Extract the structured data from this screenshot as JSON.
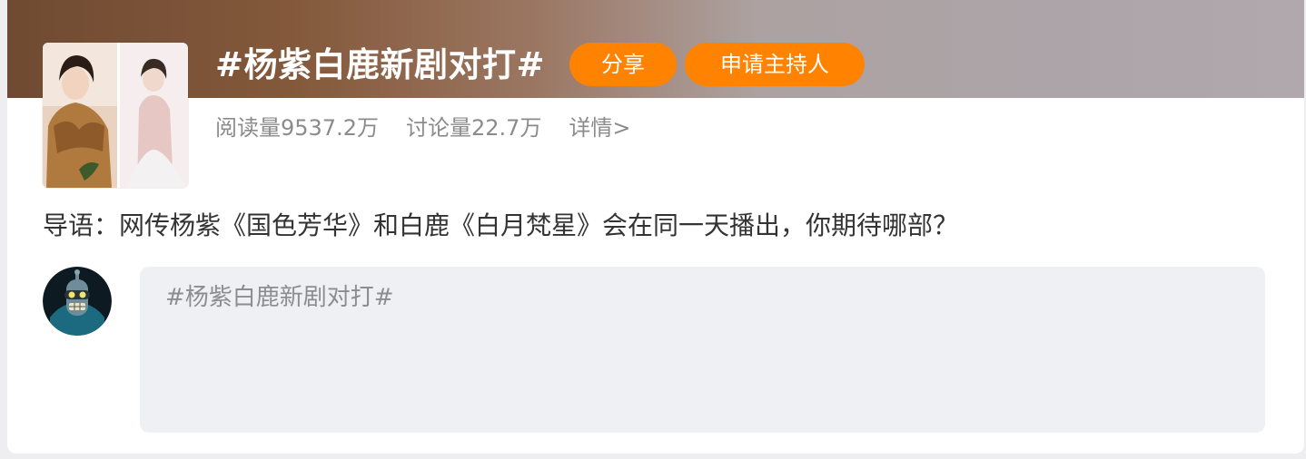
{
  "topic": {
    "title": "#杨紫白鹿新剧对打#",
    "share_label": "分享",
    "host_label": "申请主持人",
    "read_count": "阅读量9537.2万",
    "discuss_count": "讨论量22.7万",
    "details_link": "详情>",
    "intro": "导语：网传杨紫《国色芳华》和白鹿《白月梵星》会在同一天播出，你期待哪部？"
  },
  "composer": {
    "draft_text": "#杨紫白鹿新剧对打#"
  },
  "colors": {
    "accent": "#ff8200",
    "banner_start": "#6f4a32",
    "banner_end": "#b1a8ad",
    "compose_bg": "#eff0f3",
    "muted_text": "#8b8b8b"
  },
  "icons": {
    "cover": "topic-cover-image",
    "avatar": "robot-avatar"
  }
}
